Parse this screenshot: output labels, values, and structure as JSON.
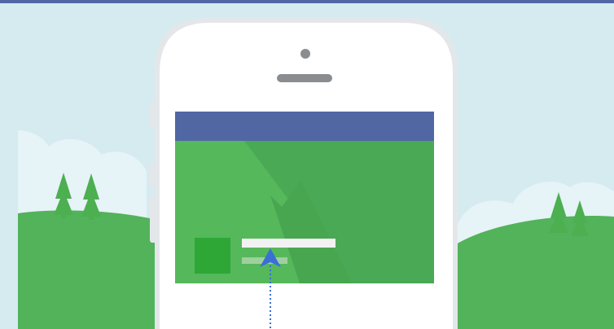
{
  "illustration": {
    "subject": "phone-with-mobile-page-preview",
    "colors": {
      "sky": "#d5ebf0",
      "top_border": "#5067a4",
      "cloud": "#e6f3f7",
      "hill_back": "#4eac4e",
      "hill_front": "#52b35a",
      "tree": "#4caf50",
      "phone_body": "#ffffff",
      "phone_rim": "#e4e7ea",
      "speaker": "#8a8d90",
      "nav_bar": "#5067a4",
      "cover_light": "#55b85b",
      "cover_dark": "#4aa955",
      "mountain": "#47a64f",
      "profile_square": "#2ea737",
      "name_bar": "#f2f2f2",
      "sub_bar": "#9fcf9f",
      "arrow": "#3b6fd6"
    }
  }
}
